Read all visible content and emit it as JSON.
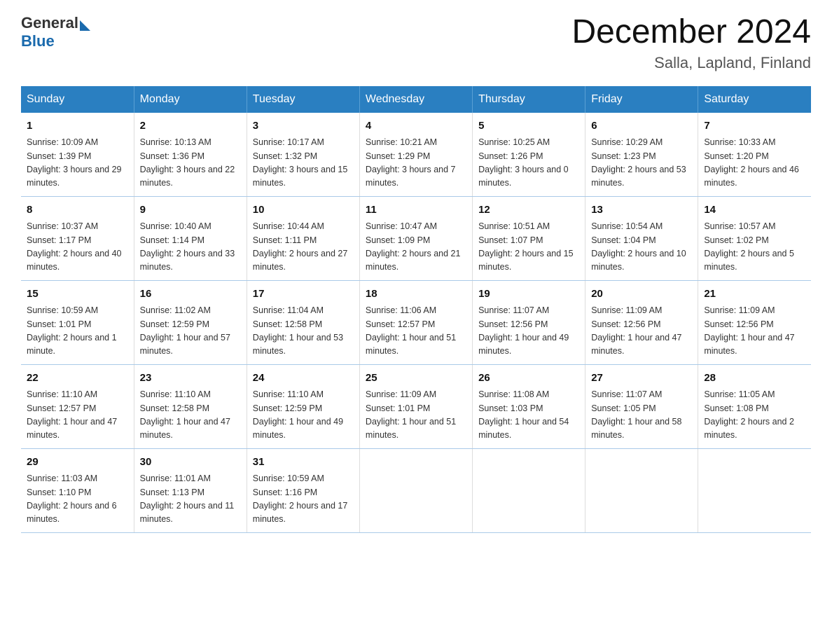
{
  "header": {
    "title": "December 2024",
    "location": "Salla, Lapland, Finland",
    "logo_general": "General",
    "logo_blue": "Blue"
  },
  "calendar": {
    "days_of_week": [
      "Sunday",
      "Monday",
      "Tuesday",
      "Wednesday",
      "Thursday",
      "Friday",
      "Saturday"
    ],
    "weeks": [
      [
        {
          "day": "1",
          "sunrise": "Sunrise: 10:09 AM",
          "sunset": "Sunset: 1:39 PM",
          "daylight": "Daylight: 3 hours and 29 minutes."
        },
        {
          "day": "2",
          "sunrise": "Sunrise: 10:13 AM",
          "sunset": "Sunset: 1:36 PM",
          "daylight": "Daylight: 3 hours and 22 minutes."
        },
        {
          "day": "3",
          "sunrise": "Sunrise: 10:17 AM",
          "sunset": "Sunset: 1:32 PM",
          "daylight": "Daylight: 3 hours and 15 minutes."
        },
        {
          "day": "4",
          "sunrise": "Sunrise: 10:21 AM",
          "sunset": "Sunset: 1:29 PM",
          "daylight": "Daylight: 3 hours and 7 minutes."
        },
        {
          "day": "5",
          "sunrise": "Sunrise: 10:25 AM",
          "sunset": "Sunset: 1:26 PM",
          "daylight": "Daylight: 3 hours and 0 minutes."
        },
        {
          "day": "6",
          "sunrise": "Sunrise: 10:29 AM",
          "sunset": "Sunset: 1:23 PM",
          "daylight": "Daylight: 2 hours and 53 minutes."
        },
        {
          "day": "7",
          "sunrise": "Sunrise: 10:33 AM",
          "sunset": "Sunset: 1:20 PM",
          "daylight": "Daylight: 2 hours and 46 minutes."
        }
      ],
      [
        {
          "day": "8",
          "sunrise": "Sunrise: 10:37 AM",
          "sunset": "Sunset: 1:17 PM",
          "daylight": "Daylight: 2 hours and 40 minutes."
        },
        {
          "day": "9",
          "sunrise": "Sunrise: 10:40 AM",
          "sunset": "Sunset: 1:14 PM",
          "daylight": "Daylight: 2 hours and 33 minutes."
        },
        {
          "day": "10",
          "sunrise": "Sunrise: 10:44 AM",
          "sunset": "Sunset: 1:11 PM",
          "daylight": "Daylight: 2 hours and 27 minutes."
        },
        {
          "day": "11",
          "sunrise": "Sunrise: 10:47 AM",
          "sunset": "Sunset: 1:09 PM",
          "daylight": "Daylight: 2 hours and 21 minutes."
        },
        {
          "day": "12",
          "sunrise": "Sunrise: 10:51 AM",
          "sunset": "Sunset: 1:07 PM",
          "daylight": "Daylight: 2 hours and 15 minutes."
        },
        {
          "day": "13",
          "sunrise": "Sunrise: 10:54 AM",
          "sunset": "Sunset: 1:04 PM",
          "daylight": "Daylight: 2 hours and 10 minutes."
        },
        {
          "day": "14",
          "sunrise": "Sunrise: 10:57 AM",
          "sunset": "Sunset: 1:02 PM",
          "daylight": "Daylight: 2 hours and 5 minutes."
        }
      ],
      [
        {
          "day": "15",
          "sunrise": "Sunrise: 10:59 AM",
          "sunset": "Sunset: 1:01 PM",
          "daylight": "Daylight: 2 hours and 1 minute."
        },
        {
          "day": "16",
          "sunrise": "Sunrise: 11:02 AM",
          "sunset": "Sunset: 12:59 PM",
          "daylight": "Daylight: 1 hour and 57 minutes."
        },
        {
          "day": "17",
          "sunrise": "Sunrise: 11:04 AM",
          "sunset": "Sunset: 12:58 PM",
          "daylight": "Daylight: 1 hour and 53 minutes."
        },
        {
          "day": "18",
          "sunrise": "Sunrise: 11:06 AM",
          "sunset": "Sunset: 12:57 PM",
          "daylight": "Daylight: 1 hour and 51 minutes."
        },
        {
          "day": "19",
          "sunrise": "Sunrise: 11:07 AM",
          "sunset": "Sunset: 12:56 PM",
          "daylight": "Daylight: 1 hour and 49 minutes."
        },
        {
          "day": "20",
          "sunrise": "Sunrise: 11:09 AM",
          "sunset": "Sunset: 12:56 PM",
          "daylight": "Daylight: 1 hour and 47 minutes."
        },
        {
          "day": "21",
          "sunrise": "Sunrise: 11:09 AM",
          "sunset": "Sunset: 12:56 PM",
          "daylight": "Daylight: 1 hour and 47 minutes."
        }
      ],
      [
        {
          "day": "22",
          "sunrise": "Sunrise: 11:10 AM",
          "sunset": "Sunset: 12:57 PM",
          "daylight": "Daylight: 1 hour and 47 minutes."
        },
        {
          "day": "23",
          "sunrise": "Sunrise: 11:10 AM",
          "sunset": "Sunset: 12:58 PM",
          "daylight": "Daylight: 1 hour and 47 minutes."
        },
        {
          "day": "24",
          "sunrise": "Sunrise: 11:10 AM",
          "sunset": "Sunset: 12:59 PM",
          "daylight": "Daylight: 1 hour and 49 minutes."
        },
        {
          "day": "25",
          "sunrise": "Sunrise: 11:09 AM",
          "sunset": "Sunset: 1:01 PM",
          "daylight": "Daylight: 1 hour and 51 minutes."
        },
        {
          "day": "26",
          "sunrise": "Sunrise: 11:08 AM",
          "sunset": "Sunset: 1:03 PM",
          "daylight": "Daylight: 1 hour and 54 minutes."
        },
        {
          "day": "27",
          "sunrise": "Sunrise: 11:07 AM",
          "sunset": "Sunset: 1:05 PM",
          "daylight": "Daylight: 1 hour and 58 minutes."
        },
        {
          "day": "28",
          "sunrise": "Sunrise: 11:05 AM",
          "sunset": "Sunset: 1:08 PM",
          "daylight": "Daylight: 2 hours and 2 minutes."
        }
      ],
      [
        {
          "day": "29",
          "sunrise": "Sunrise: 11:03 AM",
          "sunset": "Sunset: 1:10 PM",
          "daylight": "Daylight: 2 hours and 6 minutes."
        },
        {
          "day": "30",
          "sunrise": "Sunrise: 11:01 AM",
          "sunset": "Sunset: 1:13 PM",
          "daylight": "Daylight: 2 hours and 11 minutes."
        },
        {
          "day": "31",
          "sunrise": "Sunrise: 10:59 AM",
          "sunset": "Sunset: 1:16 PM",
          "daylight": "Daylight: 2 hours and 17 minutes."
        },
        {
          "day": "",
          "sunrise": "",
          "sunset": "",
          "daylight": ""
        },
        {
          "day": "",
          "sunrise": "",
          "sunset": "",
          "daylight": ""
        },
        {
          "day": "",
          "sunrise": "",
          "sunset": "",
          "daylight": ""
        },
        {
          "day": "",
          "sunrise": "",
          "sunset": "",
          "daylight": ""
        }
      ]
    ]
  }
}
